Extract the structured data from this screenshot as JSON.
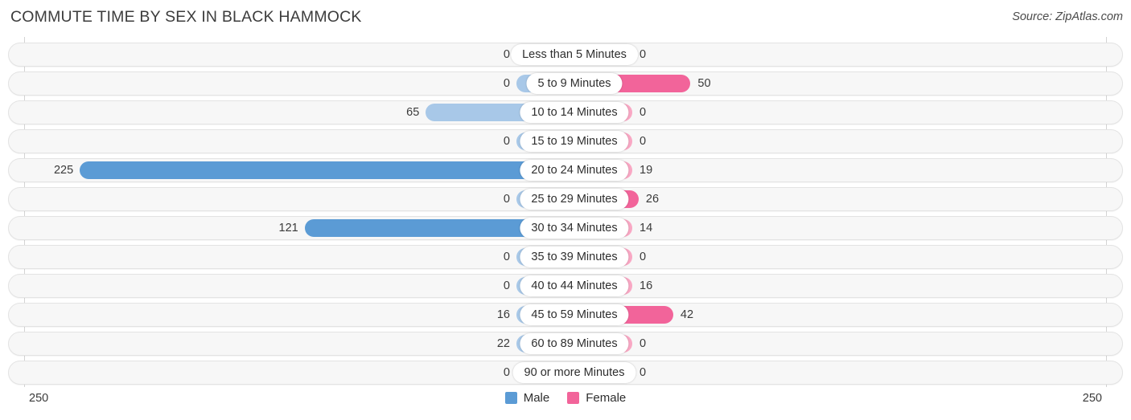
{
  "header": {
    "title": "COMMUTE TIME BY SEX IN BLACK HAMMOCK",
    "source": "Source: ZipAtlas.com"
  },
  "footer": {
    "axis_left": "250",
    "axis_right": "250"
  },
  "legend": {
    "male_label": "Male",
    "female_label": "Female",
    "male_color": "#5b9bd5",
    "female_color": "#f2649a"
  },
  "colors": {
    "male_strong": "#5b9bd5",
    "male_light": "#a8c8e8",
    "female_strong": "#f2649a",
    "female_light": "#f9a8c4",
    "track_fill": "#f7f7f7",
    "track_border": "#e3e3e3",
    "axis_line": "#d4d4d4"
  },
  "chart_data": {
    "type": "bar",
    "title": "COMMUTE TIME BY SEX IN BLACK HAMMOCK",
    "subtitle": "",
    "orientation": "horizontal-diverging",
    "xlabel": "",
    "ylabel": "",
    "axis_max": 250,
    "axis_left_tick": "250",
    "axis_right_tick": "250",
    "grid": false,
    "legend_position": "bottom-center",
    "categories": [
      "Less than 5 Minutes",
      "5 to 9 Minutes",
      "10 to 14 Minutes",
      "15 to 19 Minutes",
      "20 to 24 Minutes",
      "25 to 29 Minutes",
      "30 to 34 Minutes",
      "35 to 39 Minutes",
      "40 to 44 Minutes",
      "45 to 59 Minutes",
      "60 to 89 Minutes",
      "90 or more Minutes"
    ],
    "series": [
      {
        "name": "Male",
        "color": "#5b9bd5",
        "values": [
          0,
          0,
          65,
          0,
          225,
          0,
          121,
          0,
          0,
          16,
          22,
          0
        ]
      },
      {
        "name": "Female",
        "color": "#f2649a",
        "values": [
          0,
          50,
          0,
          0,
          19,
          26,
          14,
          0,
          16,
          42,
          0,
          0
        ]
      }
    ],
    "rows": [
      {
        "category": "Less than 5 Minutes",
        "male": 0,
        "male_label": "0",
        "female": 0,
        "female_label": "0"
      },
      {
        "category": "5 to 9 Minutes",
        "male": 0,
        "male_label": "0",
        "female": 50,
        "female_label": "50"
      },
      {
        "category": "10 to 14 Minutes",
        "male": 65,
        "male_label": "65",
        "female": 0,
        "female_label": "0"
      },
      {
        "category": "15 to 19 Minutes",
        "male": 0,
        "male_label": "0",
        "female": 0,
        "female_label": "0"
      },
      {
        "category": "20 to 24 Minutes",
        "male": 225,
        "male_label": "225",
        "female": 19,
        "female_label": "19"
      },
      {
        "category": "25 to 29 Minutes",
        "male": 0,
        "male_label": "0",
        "female": 26,
        "female_label": "26"
      },
      {
        "category": "30 to 34 Minutes",
        "male": 121,
        "male_label": "121",
        "female": 14,
        "female_label": "14"
      },
      {
        "category": "35 to 39 Minutes",
        "male": 0,
        "male_label": "0",
        "female": 0,
        "female_label": "0"
      },
      {
        "category": "40 to 44 Minutes",
        "male": 0,
        "male_label": "0",
        "female": 16,
        "female_label": "16"
      },
      {
        "category": "45 to 59 Minutes",
        "male": 16,
        "male_label": "16",
        "female": 42,
        "female_label": "42"
      },
      {
        "category": "60 to 89 Minutes",
        "male": 22,
        "male_label": "22",
        "female": 0,
        "female_label": "0"
      },
      {
        "category": "90 or more Minutes",
        "male": 0,
        "male_label": "0",
        "female": 0,
        "female_label": "0"
      }
    ]
  }
}
